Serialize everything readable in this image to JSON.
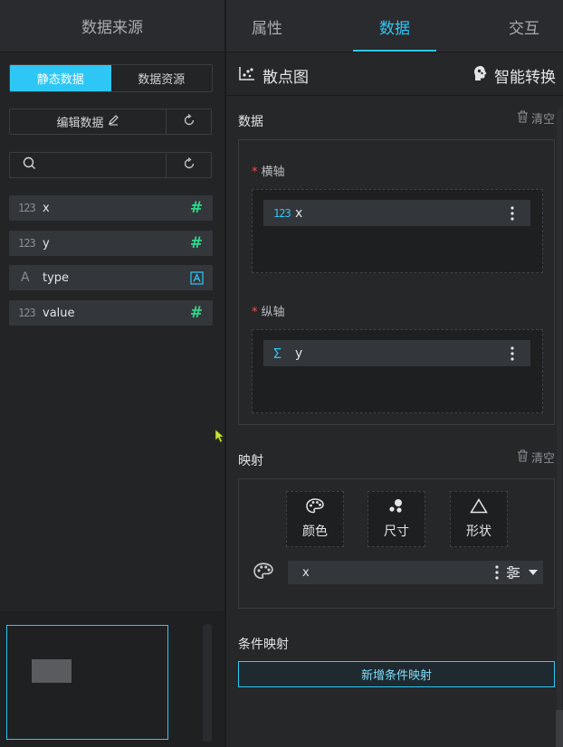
{
  "left": {
    "title": "数据来源",
    "segment": {
      "static": "静态数据",
      "resource": "数据资源"
    },
    "edit_label": "编辑数据",
    "search_placeholder": "",
    "fields": [
      {
        "type_label": "123",
        "name": "x",
        "kind": "number"
      },
      {
        "type_label": "123",
        "name": "y",
        "kind": "number"
      },
      {
        "type_label": "A",
        "name": "type",
        "kind": "text"
      },
      {
        "type_label": "123",
        "name": "value",
        "kind": "number"
      }
    ]
  },
  "tabs": {
    "props": "属性",
    "data": "数据",
    "interact": "交互"
  },
  "chart": {
    "type_label": "散点图",
    "convert_label": "智能转换"
  },
  "data_section": {
    "title": "数据",
    "clear": "清空",
    "x_axis": {
      "label": "横轴",
      "required": "*",
      "field_type": "123",
      "field": "x"
    },
    "y_axis": {
      "label": "纵轴",
      "required": "*",
      "field_type": "Σ",
      "field": "y"
    }
  },
  "mapping": {
    "title": "映射",
    "clear": "清空",
    "buttons": {
      "color": "颜色",
      "size": "尺寸",
      "shape": "形状"
    },
    "row_field": "x"
  },
  "condition": {
    "title": "条件映射",
    "add_button": "新增条件映射"
  },
  "colors": {
    "accent": "#2ec7f5",
    "number_icon": "#2ed68a",
    "required": "#f04d4d"
  }
}
